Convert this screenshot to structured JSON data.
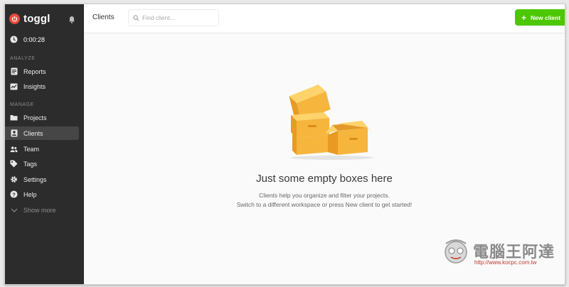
{
  "app": {
    "brand": "toggl",
    "timer": "0:00:28"
  },
  "sidebar": {
    "sections": {
      "analyze": "ANALYZE",
      "manage": "MANAGE"
    },
    "items": [
      {
        "label": "Reports",
        "icon": "reports-icon"
      },
      {
        "label": "Insights",
        "icon": "insights-icon"
      },
      {
        "label": "Projects",
        "icon": "folder-icon"
      },
      {
        "label": "Clients",
        "icon": "client-icon",
        "active": true
      },
      {
        "label": "Team",
        "icon": "team-icon"
      },
      {
        "label": "Tags",
        "icon": "tag-icon"
      },
      {
        "label": "Settings",
        "icon": "gear-icon"
      },
      {
        "label": "Help",
        "icon": "help-icon"
      },
      {
        "label": "Show more",
        "icon": "chevron-down-icon"
      }
    ]
  },
  "header": {
    "title": "Clients",
    "search": {
      "placeholder": "Find client...",
      "value": ""
    },
    "new_client_label": "New client"
  },
  "empty_state": {
    "title": "Just some empty boxes here",
    "line1": "Clients help you organize and filter your projects.",
    "line2": "Switch to a different workspace or press New client to get started!"
  },
  "watermark": {
    "text": "電腦王阿達",
    "url": "http://www.kocpc.com.tw"
  },
  "colors": {
    "sidebar": "#2c2c2c",
    "accent_green": "#4bc800",
    "brand_red": "#e24d3d",
    "box_orange": "#f6b53d"
  }
}
